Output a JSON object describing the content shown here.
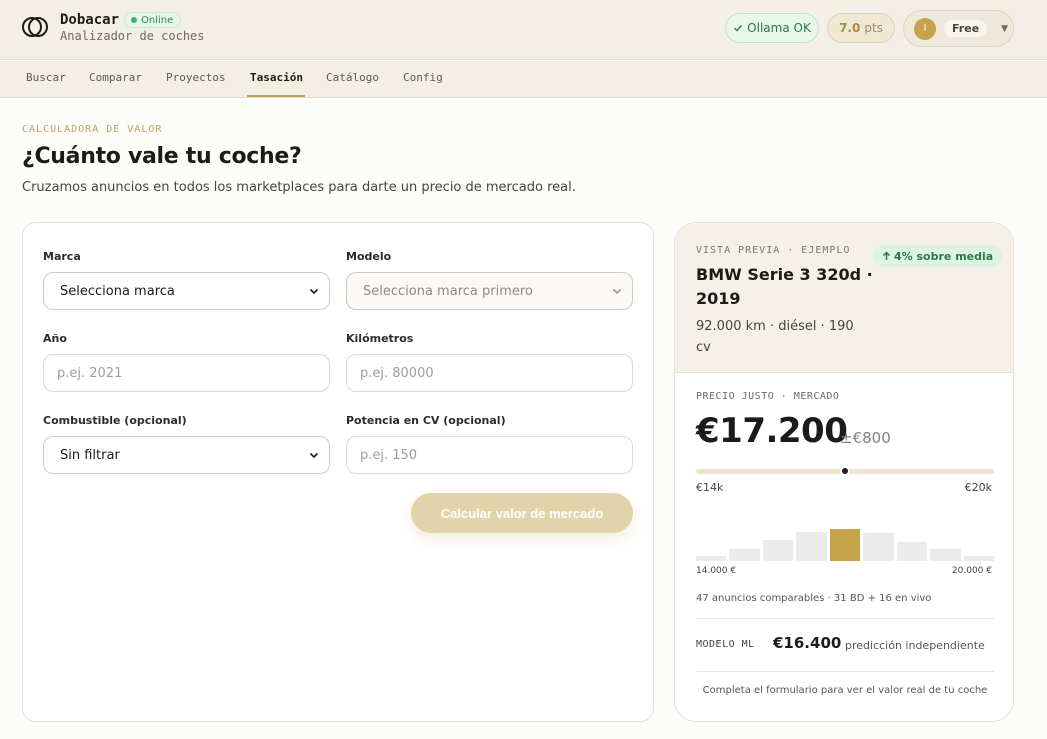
{
  "app": {
    "name": "Dobacar",
    "subtitle": "Analizador de coches",
    "status_badge": "Online"
  },
  "header": {
    "ollama_status": "Ollama OK",
    "points_value": "7.0",
    "points_unit": "pts",
    "user_initial": "I",
    "plan": "Free",
    "icons": {
      "logo": "dobacar-logo-icon",
      "check": "check-icon",
      "chevron": "chevron-down-icon"
    }
  },
  "nav": {
    "tabs": [
      {
        "label": "Buscar"
      },
      {
        "label": "Comparar"
      },
      {
        "label": "Proyectos"
      },
      {
        "label": "Tasación",
        "active": true
      },
      {
        "label": "Catálogo"
      },
      {
        "label": "Config"
      }
    ]
  },
  "hero": {
    "eyebrow": "CALCULADORA DE VALOR",
    "title": "¿Cuánto vale tu coche?",
    "subtitle": "Cruzamos anuncios en todos los marketplaces para darte un precio de mercado real."
  },
  "form": {
    "brand": {
      "label": "Marca",
      "value": "Selecciona marca"
    },
    "model": {
      "label": "Modelo",
      "value": "Selecciona marca primero",
      "disabled": true
    },
    "year": {
      "label": "Año",
      "placeholder": "p.ej. 2021"
    },
    "km": {
      "label": "Kilómetros",
      "placeholder": "p.ej. 80000"
    },
    "fuel": {
      "label": "Combustible (opcional)",
      "value": "Sin filtrar"
    },
    "power": {
      "label": "Potencia en CV (opcional)",
      "placeholder": "p.ej. 150"
    },
    "submit_label": "Calcular valor de mercado"
  },
  "preview": {
    "eyebrow": "VISTA PREVIA · EJEMPLO",
    "trend_badge": "4% sobre media",
    "car_title": "BMW Serie 3 320d · 2019",
    "car_specs": "92.000 km · diésel · 190 cv",
    "fair_price_label": "PRECIO JUSTO · MERCADO",
    "price": "€17.200",
    "price_range": "±€800",
    "range_min": "€14k",
    "range_max": "€20k",
    "range_position": 0.5,
    "histogram_min": "14.000 €",
    "histogram_max": "20.000 €",
    "histogram_levels": [
      0.18,
      0.42,
      0.72,
      1.0,
      1.12,
      0.98,
      0.66,
      0.4,
      0.18
    ],
    "histogram_highlight_index": 4,
    "comparables": "47 anuncios comparables · 31 BD + 16 en vivo",
    "ml_label": "MODELO ML",
    "ml_value": "€16.400",
    "ml_note": "predicción independiente",
    "complete_note": "Completa el formulario para ver el valor real de tu coche"
  },
  "colors": {
    "accent_gold": "#c6a24a",
    "header_bg": "#f3efe6",
    "success_green": "#2c7a46",
    "button_disabled": "#e3d3aa"
  }
}
